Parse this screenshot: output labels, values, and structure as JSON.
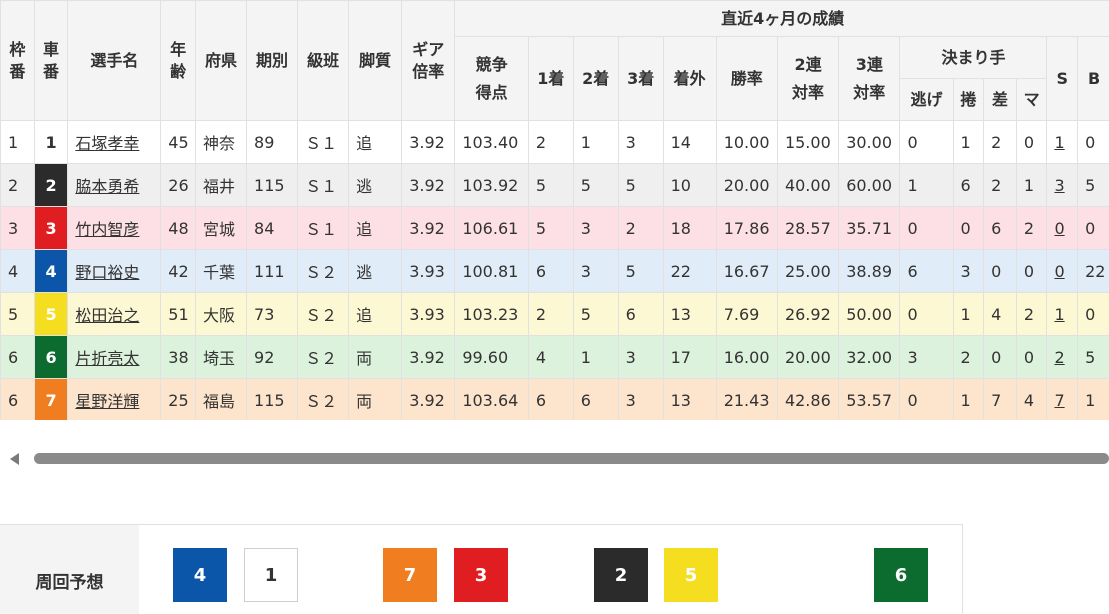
{
  "headers": {
    "waku": "枠番",
    "sha": "車番",
    "name": "選手名",
    "age": "年齢",
    "pref": "府県",
    "term": "期別",
    "class": "級班",
    "style": "脚質",
    "gear": "ギア倍率",
    "recent": "直近4ヶ月の成績",
    "score": "競争得点",
    "first": "1着",
    "second": "2着",
    "third": "3着",
    "out": "着外",
    "winrate": "勝率",
    "ren2": "2連対率",
    "ren3": "3連対率",
    "kimarite": "決まり手",
    "nige": "逃げ",
    "makuri": "捲",
    "sashi": "差",
    "mark": "マ",
    "s": "S",
    "b": "B"
  },
  "riders": [
    {
      "waku": "1",
      "car": "1",
      "name": "石塚孝幸",
      "age": "45",
      "pref": "神奈",
      "term": "89",
      "class": "Ｓ１",
      "style": "追",
      "gear": "3.92",
      "score": "103.40",
      "first": "2",
      "second": "1",
      "third": "3",
      "out": "14",
      "winrate": "10.00",
      "ren2": "15.00",
      "ren3": "30.00",
      "nige": "0",
      "makuri": "1",
      "sashi": "2",
      "mark": "0",
      "s": "1",
      "b": "0",
      "carBg": "#ffffff",
      "carFg": "#333333"
    },
    {
      "waku": "2",
      "car": "2",
      "name": "脇本勇希",
      "age": "26",
      "pref": "福井",
      "term": "115",
      "class": "Ｓ１",
      "style": "逃",
      "gear": "3.92",
      "score": "103.92",
      "first": "5",
      "second": "5",
      "third": "5",
      "out": "10",
      "winrate": "20.00",
      "ren2": "40.00",
      "ren3": "60.00",
      "nige": "1",
      "makuri": "6",
      "sashi": "2",
      "mark": "1",
      "s": "3",
      "b": "5",
      "carBg": "#2b2b2b",
      "carFg": "#ffffff"
    },
    {
      "waku": "3",
      "car": "3",
      "name": "竹内智彦",
      "age": "48",
      "pref": "宮城",
      "term": "84",
      "class": "Ｓ１",
      "style": "追",
      "gear": "3.92",
      "score": "106.61",
      "first": "5",
      "second": "3",
      "third": "2",
      "out": "18",
      "winrate": "17.86",
      "ren2": "28.57",
      "ren3": "35.71",
      "nige": "0",
      "makuri": "0",
      "sashi": "6",
      "mark": "2",
      "s": "0",
      "b": "0",
      "carBg": "#e01e22",
      "carFg": "#ffffff"
    },
    {
      "waku": "4",
      "car": "4",
      "name": "野口裕史",
      "age": "42",
      "pref": "千葉",
      "term": "111",
      "class": "Ｓ２",
      "style": "逃",
      "gear": "3.93",
      "score": "100.81",
      "first": "6",
      "second": "3",
      "third": "5",
      "out": "22",
      "winrate": "16.67",
      "ren2": "25.00",
      "ren3": "38.89",
      "nige": "6",
      "makuri": "3",
      "sashi": "0",
      "mark": "0",
      "s": "0",
      "b": "22",
      "carBg": "#0b56a8",
      "carFg": "#ffffff"
    },
    {
      "waku": "5",
      "car": "5",
      "name": "松田治之",
      "age": "51",
      "pref": "大阪",
      "term": "73",
      "class": "Ｓ２",
      "style": "追",
      "gear": "3.93",
      "score": "103.23",
      "first": "2",
      "second": "5",
      "third": "6",
      "out": "13",
      "winrate": "7.69",
      "ren2": "26.92",
      "ren3": "50.00",
      "nige": "0",
      "makuri": "1",
      "sashi": "4",
      "mark": "2",
      "s": "1",
      "b": "0",
      "carBg": "#f5dd1f",
      "carFg": "#ffffff"
    },
    {
      "waku": "6",
      "car": "6",
      "name": "片折亮太",
      "age": "38",
      "pref": "埼玉",
      "term": "92",
      "class": "Ｓ２",
      "style": "両",
      "gear": "3.92",
      "score": "99.60",
      "first": "4",
      "second": "1",
      "third": "3",
      "out": "17",
      "winrate": "16.00",
      "ren2": "20.00",
      "ren3": "32.00",
      "nige": "3",
      "makuri": "2",
      "sashi": "0",
      "mark": "0",
      "s": "2",
      "b": "5",
      "carBg": "#0c6b2f",
      "carFg": "#ffffff"
    },
    {
      "waku": "6",
      "car": "7",
      "name": "星野洋輝",
      "age": "25",
      "pref": "福島",
      "term": "115",
      "class": "Ｓ２",
      "style": "両",
      "gear": "3.92",
      "score": "103.64",
      "first": "6",
      "second": "6",
      "third": "3",
      "out": "13",
      "winrate": "21.43",
      "ren2": "42.86",
      "ren3": "53.57",
      "nige": "0",
      "makuri": "1",
      "sashi": "7",
      "mark": "4",
      "s": "7",
      "b": "1",
      "carBg": "#f07d1f",
      "carFg": "#ffffff"
    }
  ],
  "lap": {
    "label": "周回予想",
    "boxes": [
      {
        "num": "4",
        "bg": "#0b56a8",
        "fg": "#ffffff"
      },
      {
        "num": "1",
        "bg": "#ffffff",
        "fg": "#333333"
      },
      {
        "num": "7",
        "bg": "#f07d1f",
        "fg": "#ffffff"
      },
      {
        "num": "3",
        "bg": "#e01e22",
        "fg": "#ffffff"
      },
      {
        "num": "2",
        "bg": "#2b2b2b",
        "fg": "#ffffff"
      },
      {
        "num": "5",
        "bg": "#f5dd1f",
        "fg": "#ffffff"
      },
      {
        "num": "6",
        "bg": "#0c6b2f",
        "fg": "#ffffff"
      }
    ]
  }
}
